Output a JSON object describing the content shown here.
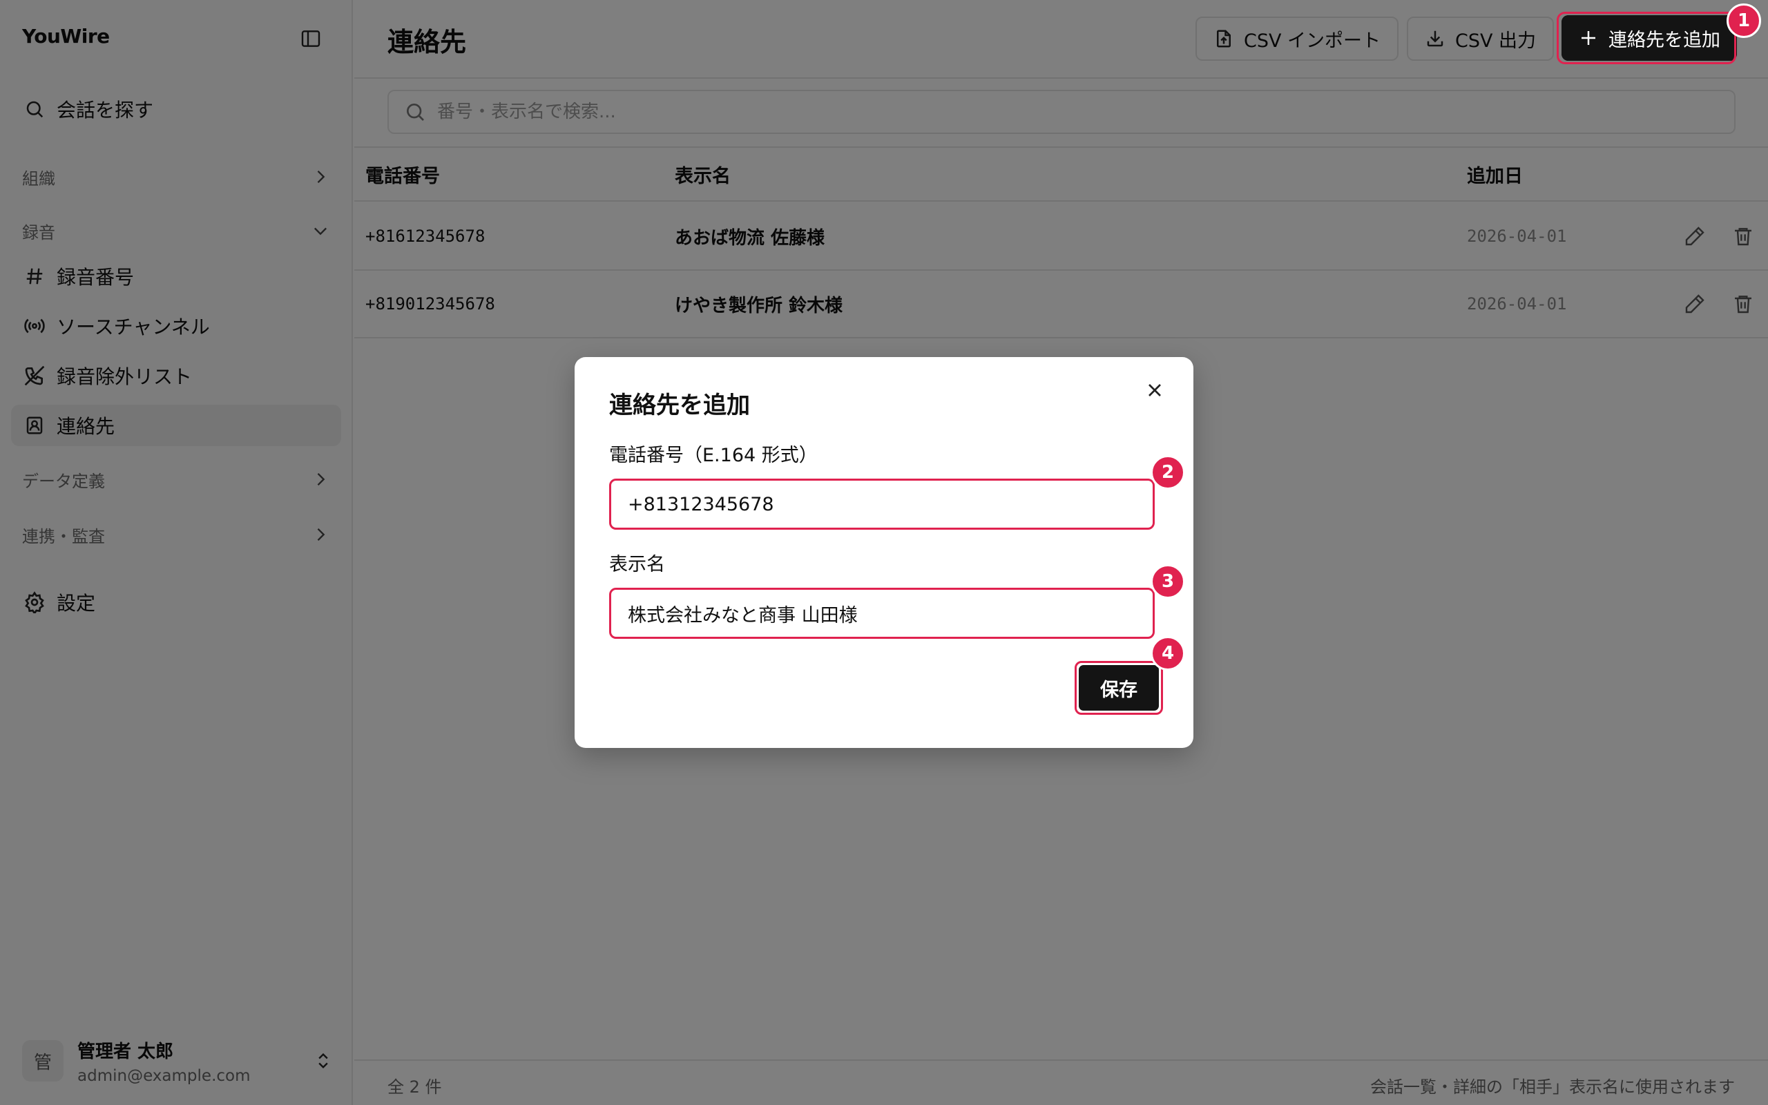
{
  "sidebar": {
    "brand": "YouWire",
    "toggle_icon": "sidebar-toggle-icon",
    "search_label": "会話を探す",
    "groups": {
      "org": "組織",
      "recording": "録音",
      "data_def": "データ定義",
      "integration": "連携・監査"
    },
    "recording_items": [
      {
        "label": "録音番号",
        "icon": "hash-icon"
      },
      {
        "label": "ソースチャンネル",
        "icon": "radio-icon"
      },
      {
        "label": "録音除外リスト",
        "icon": "phone-off-icon"
      },
      {
        "label": "連絡先",
        "icon": "contact-book-icon"
      }
    ],
    "settings_label": "設定",
    "user": {
      "avatar": "管",
      "name": "管理者 太郎",
      "email": "admin@example.com"
    }
  },
  "header": {
    "title": "連絡先",
    "csv_import": "CSV インポート",
    "csv_export": "CSV 出力",
    "add_contact": "連絡先を追加"
  },
  "search": {
    "placeholder": "番号・表示名で検索..."
  },
  "table": {
    "columns": {
      "phone": "電話番号",
      "name": "表示名",
      "added": "追加日"
    },
    "rows": [
      {
        "phone": "+81612345678",
        "name": "あおば物流 佐藤様",
        "added": "2026-04-01"
      },
      {
        "phone": "+819012345678",
        "name": "けやき製作所 鈴木様",
        "added": "2026-04-01"
      }
    ]
  },
  "footer": {
    "count": "全 2 件",
    "hint": "会話一覧・詳細の「相手」表示名に使用されます"
  },
  "modal": {
    "title": "連絡先を追加",
    "phone_label": "電話番号（E.164 形式）",
    "phone_value": "+81312345678",
    "name_label": "表示名",
    "name_value": "株式会社みなと商事 山田様",
    "save": "保存"
  },
  "badges": [
    "1",
    "2",
    "3",
    "4"
  ],
  "colors": {
    "highlight": "#e0224f",
    "primary_button": "#141414",
    "overlay": "rgba(0,0,0,0.5)"
  }
}
